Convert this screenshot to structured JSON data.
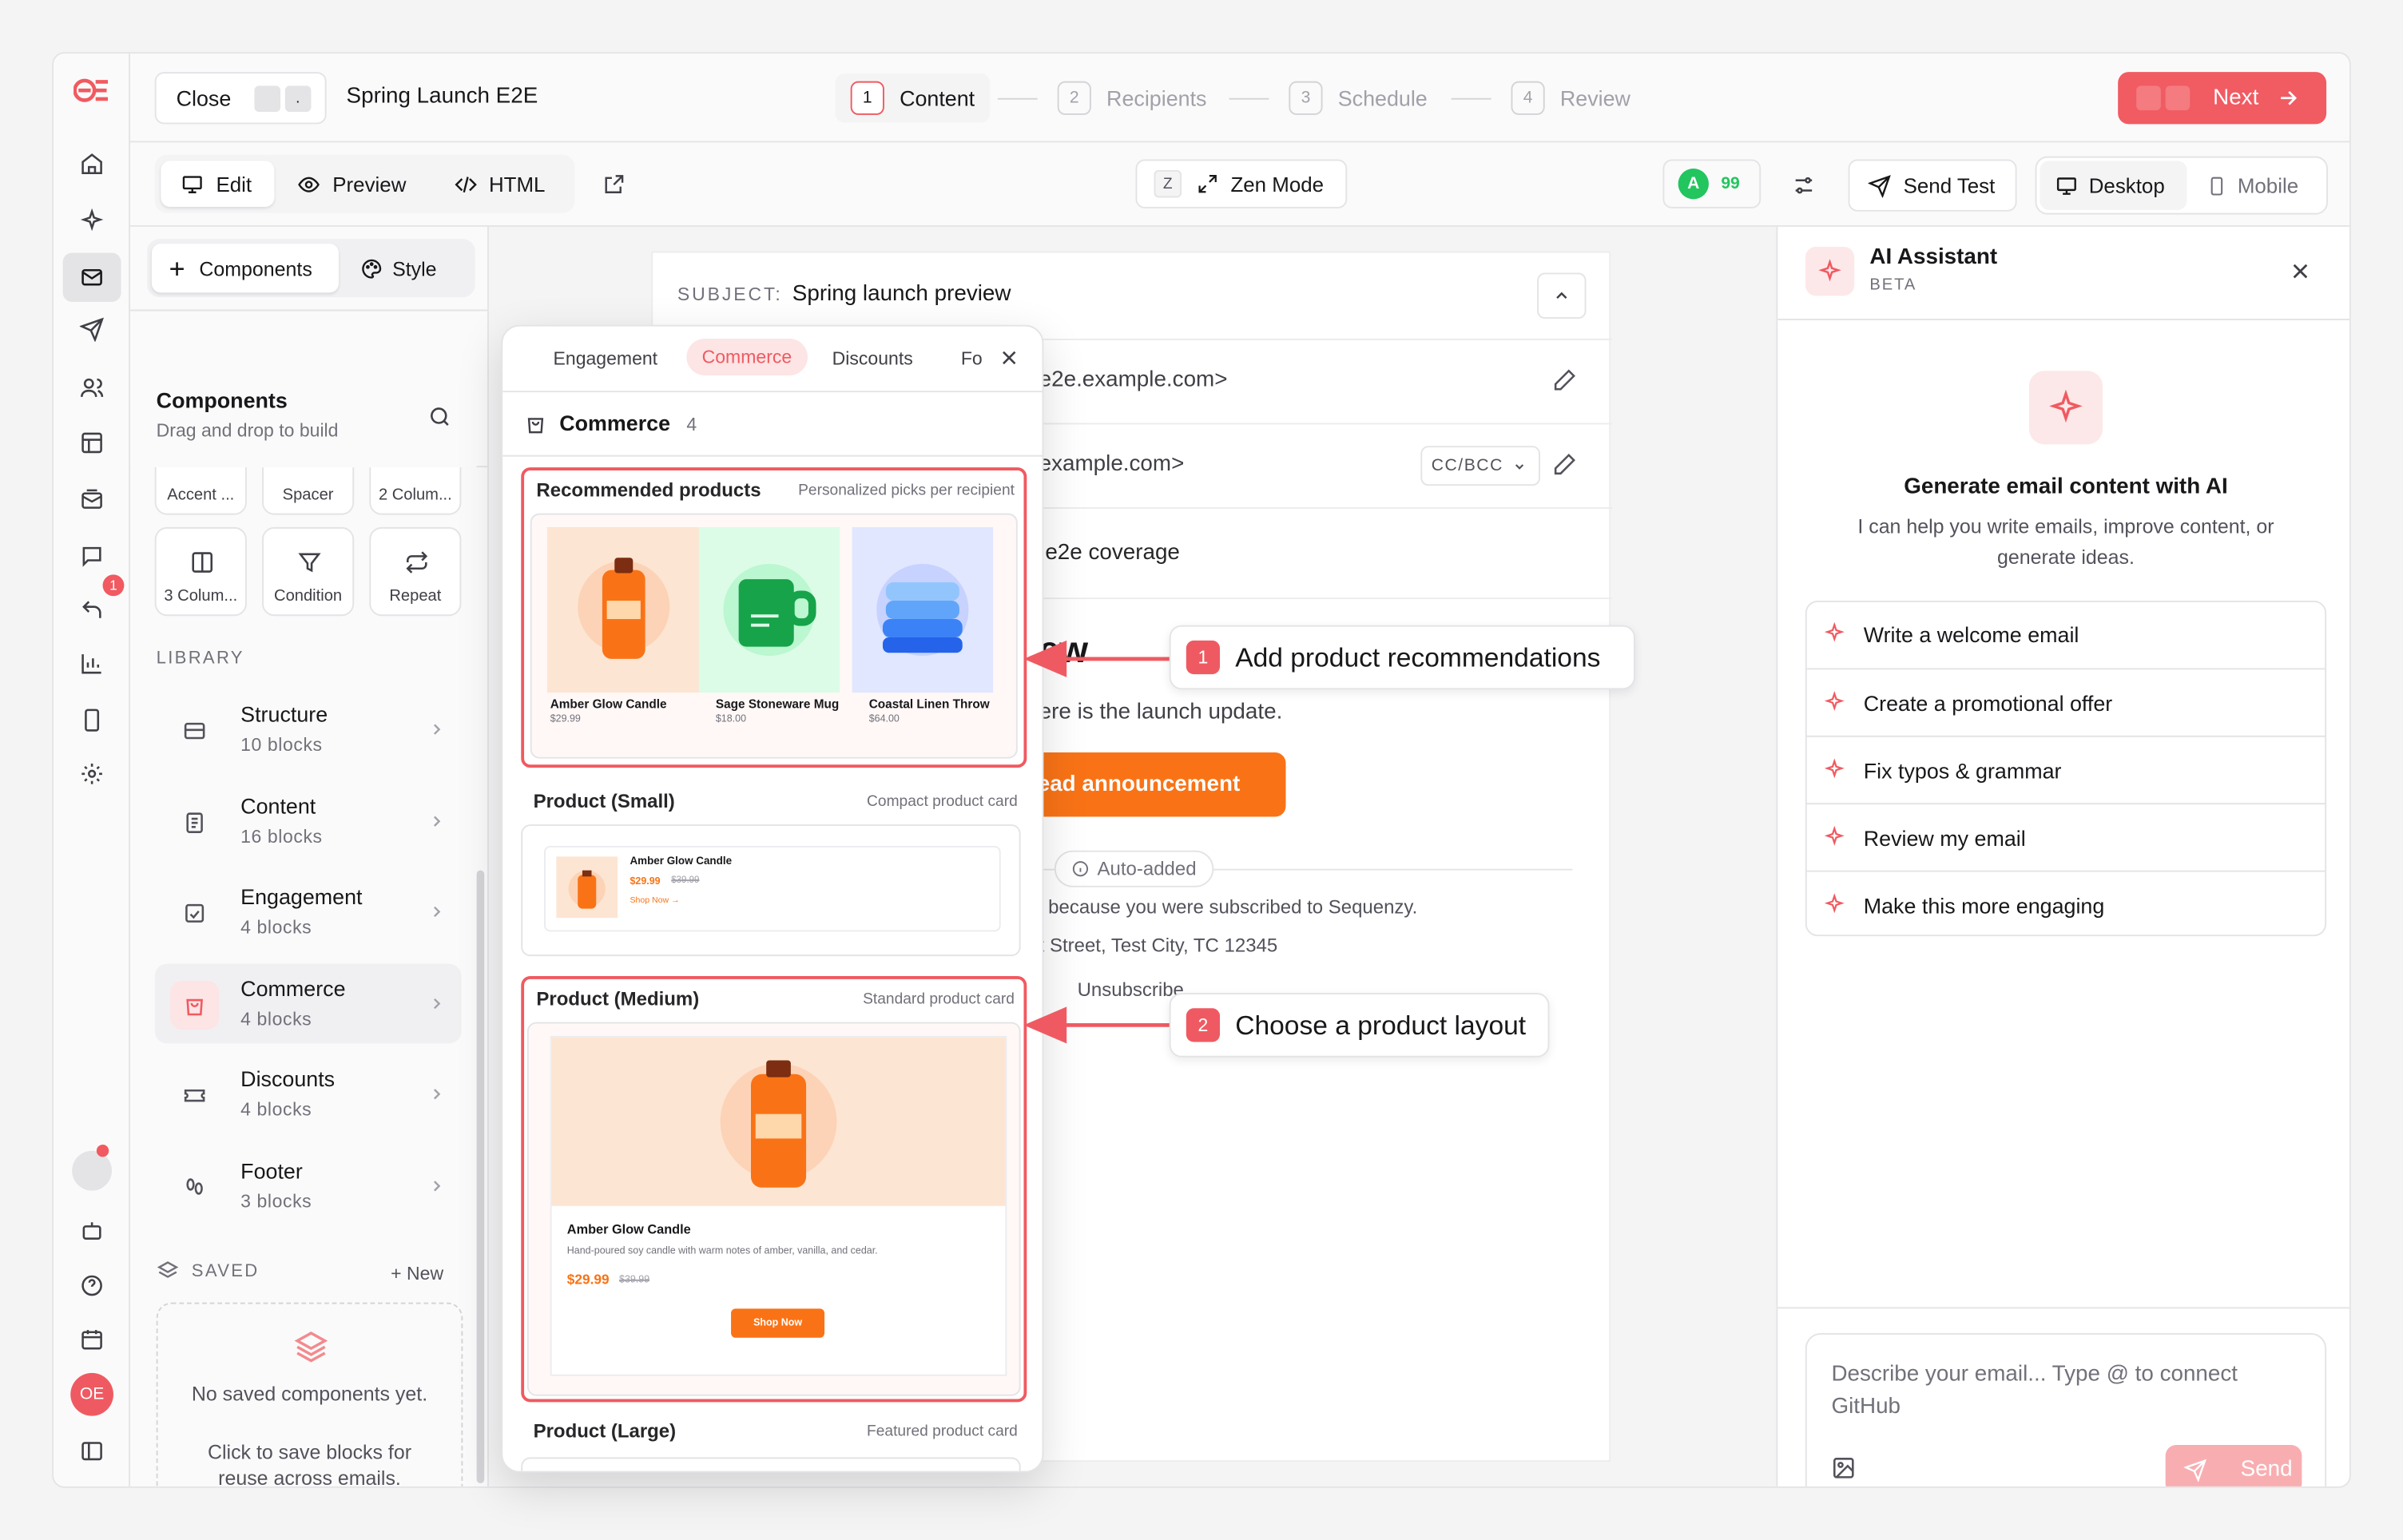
{
  "topbar": {
    "close_label": "Close",
    "shortcut_dot": ".",
    "campaign_title": "Spring Launch E2E",
    "next_label": "Next",
    "steps": [
      {
        "num": "1",
        "label": "Content"
      },
      {
        "num": "2",
        "label": "Recipients"
      },
      {
        "num": "3",
        "label": "Schedule"
      },
      {
        "num": "4",
        "label": "Review"
      }
    ]
  },
  "toolbar": {
    "edit": "Edit",
    "preview": "Preview",
    "html": "HTML",
    "zen_key": "Z",
    "zen": "Zen Mode",
    "score_badge": "A",
    "score": "99",
    "send_test": "Send Test",
    "desktop": "Desktop",
    "mobile": "Mobile"
  },
  "left": {
    "tab_components": "Components",
    "tab_style": "Style",
    "title": "Components",
    "subtitle": "Drag and drop to build",
    "top_tiles": [
      "Accent ...",
      "Spacer",
      "2 Colum..."
    ],
    "tiles": [
      "3 Colum...",
      "Condition",
      "Repeat"
    ],
    "library_header": "LIBRARY",
    "library": [
      {
        "label": "Structure",
        "count": "10 blocks"
      },
      {
        "label": "Content",
        "count": "16 blocks"
      },
      {
        "label": "Engagement",
        "count": "4 blocks"
      },
      {
        "label": "Commerce",
        "count": "4 blocks"
      },
      {
        "label": "Discounts",
        "count": "4 blocks"
      },
      {
        "label": "Footer",
        "count": "3 blocks"
      }
    ],
    "saved_header": "SAVED",
    "saved_new": "+ New",
    "saved_empty_1": "No saved components yet.",
    "saved_empty_2": "Click to save blocks for reuse across emails."
  },
  "rail": {
    "inbox_badge": "1",
    "avatar": "OE"
  },
  "email": {
    "subject_label": "SUBJECT:",
    "subject": "Spring launch preview",
    "from_frag": "e2e.example.com>",
    "to_frag": "example.com>",
    "ccbcc": "CC/BCC",
    "line_frag": "e2e coverage",
    "heading_frag": "ew",
    "body_frag": "ere is the launch update.",
    "cta_frag": "ead announcement",
    "auto_added": "Auto-added",
    "footer1": "because you were subscribed to Sequenzy.",
    "footer2": "t Street, Test City, TC 12345",
    "unsubscribe": "Unsubscribe"
  },
  "popover": {
    "tabs": [
      "Engagement",
      "Commerce",
      "Discounts",
      "Fo"
    ],
    "header": "Commerce",
    "count": "4",
    "cards": [
      {
        "title": "Recommended products",
        "subtitle": "Personalized picks per recipient"
      },
      {
        "title": "Product (Small)",
        "subtitle": "Compact product card"
      },
      {
        "title": "Product (Medium)",
        "subtitle": "Standard product card"
      },
      {
        "title": "Product (Large)",
        "subtitle": "Featured product card"
      }
    ],
    "products": [
      {
        "name": "Amber Glow Candle",
        "price": "$29.99"
      },
      {
        "name": "Sage Stoneware Mug",
        "price": "$18.00"
      },
      {
        "name": "Coastal Linen Throw",
        "price": "$64.00"
      }
    ],
    "small": {
      "name": "Amber Glow Candle",
      "price": "$29.99",
      "old": "$39.99",
      "link": "Shop Now →"
    },
    "medium": {
      "name": "Amber Glow Candle",
      "desc": "Hand-poured soy candle with warm notes of amber, vanilla, and cedar.",
      "price": "$29.99",
      "old": "$39.99",
      "cta": "Shop Now"
    }
  },
  "callouts": [
    {
      "num": "1",
      "text": "Add product recommendations"
    },
    {
      "num": "2",
      "text": "Choose a product layout"
    }
  ],
  "ai": {
    "title": "AI Assistant",
    "beta": "BETA",
    "heading": "Generate email content with AI",
    "desc": "I can help you write emails, improve content, or generate ideas.",
    "suggestions": [
      "Write a welcome email",
      "Create a promotional offer",
      "Fix typos & grammar",
      "Review my email",
      "Make this more engaging"
    ],
    "input_placeholder": "Describe your email... Type @ to connect GitHub",
    "send": "Send"
  },
  "colors": {
    "accent": "#f05a60",
    "orange": "#f97316",
    "score_green": "#22c55e"
  }
}
